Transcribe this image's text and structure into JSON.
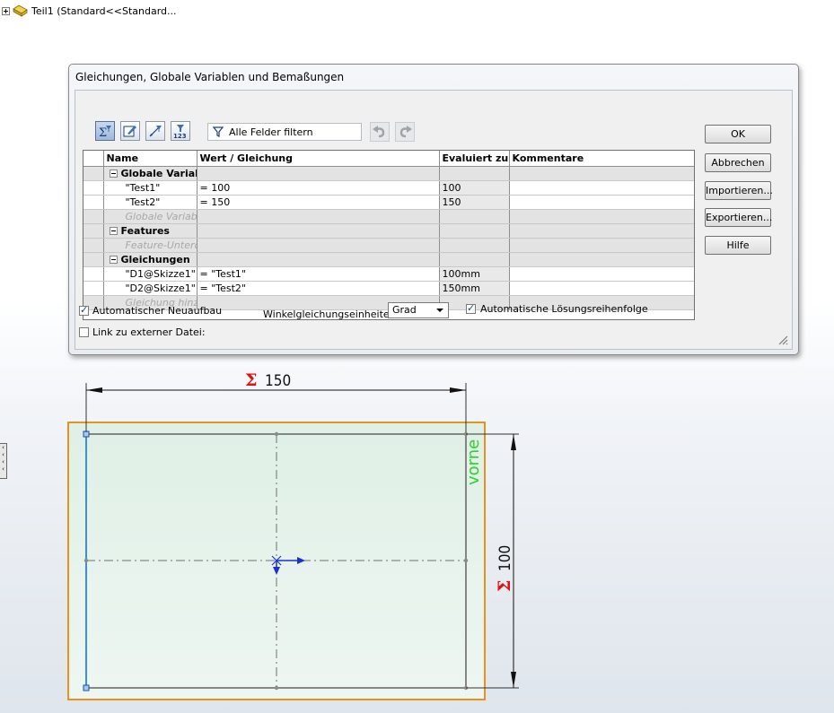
{
  "tree": {
    "label": "Teil1  (Standard<<Standard..."
  },
  "dialog": {
    "title": "Gleichungen, Globale Variablen und Bemaßungen",
    "filter_text": "Alle Felder filtern",
    "columns": [
      "Name",
      "Wert / Gleichung",
      "Evaluiert zu",
      "Kommentare"
    ],
    "groups": {
      "globals": {
        "title": "Globale Variable",
        "placeholder": "Globale Variable"
      },
      "features": {
        "title": "Features",
        "placeholder": "Feature-Unterdr"
      },
      "equations": {
        "title": "Gleichungen",
        "placeholder": "Gleichung hinzu"
      }
    },
    "rows": {
      "test1": {
        "name": "\"Test1\"",
        "value": "= 100",
        "eval": "100",
        "comment": ""
      },
      "test2": {
        "name": "\"Test2\"",
        "value": "= 150",
        "eval": "150",
        "comment": ""
      },
      "d1": {
        "name": "\"D1@Skizze1\"",
        "value": "= \"Test1\"",
        "eval": "100mm",
        "comment": ""
      },
      "d2": {
        "name": "\"D2@Skizze1\"",
        "value": "= \"Test2\"",
        "eval": "150mm",
        "comment": ""
      }
    },
    "buttons": {
      "ok": "OK",
      "cancel": "Abbrechen",
      "import": "Importieren...",
      "export": "Exportieren...",
      "help": "Hilfe"
    },
    "options": {
      "auto_rebuild": "Automatischer Neuaufbau",
      "auto_rebuild_checked": true,
      "angle_unit_label": "Winkelgleichungseinheite",
      "angle_unit": "Grad",
      "auto_order": "Automatische Lösungsreihenfolge",
      "auto_order_checked": true,
      "link_external": "Link zu externer Datei:",
      "link_external_checked": false
    }
  },
  "drawing": {
    "dim_horizontal": "150",
    "dim_vertical": "100",
    "sigma": "Σ",
    "view_label": "vorne",
    "colors": {
      "edge": "#e6921e",
      "sigma": "#e01010",
      "view_label": "#2fd02f",
      "sketch_line": "#3a8ee6",
      "origin": "#1a2fd0"
    }
  }
}
